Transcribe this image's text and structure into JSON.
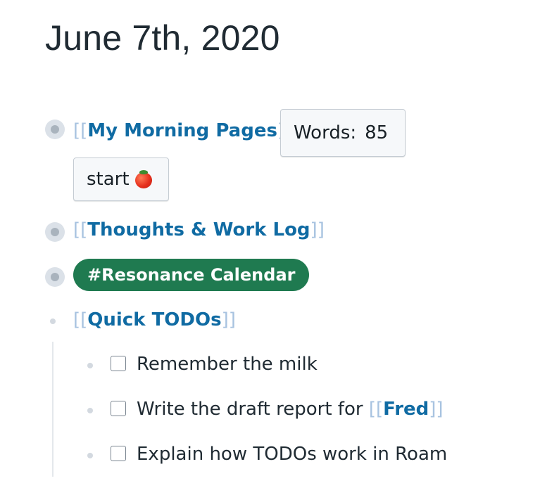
{
  "page": {
    "title": "June 7th, 2020"
  },
  "blocks": {
    "morning_pages": {
      "bracket_open": "[[",
      "link": "My Morning Pages",
      "bracket_close": "]]",
      "words_label": "Words:",
      "words_count": "85",
      "start_label": "start"
    },
    "thoughts": {
      "bracket_open": "[[",
      "link": "Thoughts & Work Log",
      "bracket_close": "]]"
    },
    "resonance": {
      "tag": "#Resonance Calendar"
    },
    "quick_todos": {
      "bracket_open": "[[",
      "link": "Quick TODOs",
      "bracket_close": "]]",
      "children": [
        {
          "text": "Remember the milk",
          "done": false
        },
        {
          "text": "Write the draft report for ",
          "link": "Fred",
          "bracket_open": "[[",
          "bracket_close": "]]",
          "done": false
        },
        {
          "text": "Explain how TODOs work in Roam",
          "done": false
        }
      ]
    }
  },
  "colors": {
    "link": "#106ba3",
    "bracket": "#a8c3e0",
    "tag_background": "#1f7a50",
    "text": "#202b33"
  },
  "icons": {
    "start_button": "tomato-icon"
  }
}
